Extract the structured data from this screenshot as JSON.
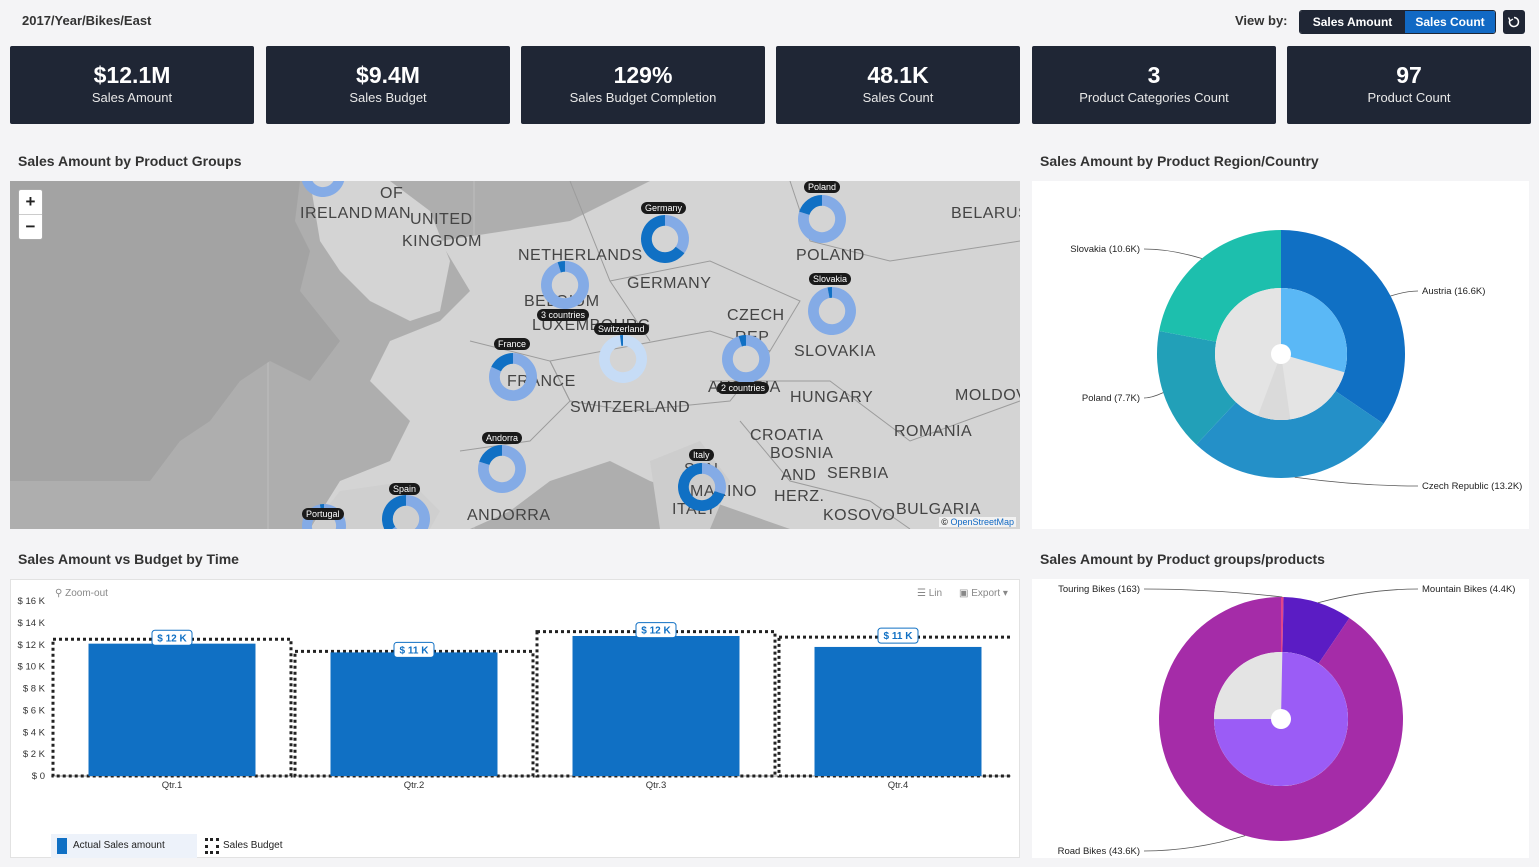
{
  "header": {
    "breadcrumb": "2017/Year/Bikes/East",
    "view_by_label": "View by:",
    "view_options": [
      "Sales Amount",
      "Sales Count"
    ],
    "reset_icon": "reset-icon"
  },
  "kpis": [
    {
      "value": "$12.1M",
      "label": "Sales Amount"
    },
    {
      "value": "$9.4M",
      "label": "Sales Budget"
    },
    {
      "value": "129%",
      "label": "Sales Budget Completion"
    },
    {
      "value": "48.1K",
      "label": "Sales Count"
    },
    {
      "value": "3",
      "label": "Product Categories Count"
    },
    {
      "value": "97",
      "label": "Product Count"
    }
  ],
  "sections": {
    "map_title": "Sales Amount by Product Groups",
    "region_title": "Sales Amount by Product Region/Country",
    "time_title": "Sales Amount vs Budget by Time",
    "products_title": "Sales Amount by Product groups/products"
  },
  "map": {
    "zoom_in": "+",
    "zoom_out": "−",
    "attribution_prefix": "©",
    "attribution_link": "OpenStreetMap",
    "place_labels": [
      "OF",
      "IRELAND",
      "MAN",
      "UNITED",
      "KINGDOM",
      "NETHERLANDS",
      "GERMANY",
      "BELGIUM",
      "LUXEMBOURG",
      "POLAND",
      "BELARUS",
      "CZECH",
      "REP",
      "SLOVAKIA",
      "FRANCE",
      "SWITZERLAND",
      "AUSTRIA",
      "HUNGARY",
      "MOLDOVA",
      "ROMANIA",
      "CROATIA",
      "BOSNIA",
      "AND",
      "HERZ.",
      "SERBIA",
      "KOSOVO",
      "BULGARIA",
      "ANDORRA",
      "ITALY",
      "SAN",
      "MARINO"
    ],
    "pins": [
      "Poland",
      "Germany",
      "Slovakia",
      "3 countries",
      "Switzerland",
      "France",
      "2 countries",
      "Andorra",
      "Italy",
      "Spain",
      "Portugal"
    ]
  },
  "chart_data": [
    {
      "type": "pie",
      "title": "Sales Amount by Product Region/Country",
      "slices": [
        {
          "label": "Austria (16.6K)",
          "value": 16.6
        },
        {
          "label": "Czech Republic (13.2K)",
          "value": 13.2
        },
        {
          "label": "Poland (7.7K)",
          "value": 7.7
        },
        {
          "label": "Slovakia (10.6K)",
          "value": 10.6
        }
      ],
      "colors": [
        "#1070c4",
        "#2490c8",
        "#22a0b8",
        "#1dbfad"
      ]
    },
    {
      "type": "bar",
      "title": "Sales Amount vs Budget by Time",
      "categories": [
        "Qtr.1",
        "Qtr.2",
        "Qtr.3",
        "Qtr.4"
      ],
      "series": [
        {
          "name": "Actual Sales amount",
          "values": [
            12.1,
            11.3,
            12.8,
            11.8
          ]
        },
        {
          "name": "Sales Budget",
          "values": [
            12.5,
            11.4,
            13.2,
            12.7
          ]
        }
      ],
      "data_labels": [
        "$ 12 K",
        "$ 11 K",
        "$ 12 K",
        "$ 11 K"
      ],
      "yticks": [
        "$ 0",
        "$ 2 K",
        "$ 4 K",
        "$ 6 K",
        "$ 8 K",
        "$ 10 K",
        "$ 12 K",
        "$ 14 K",
        "$ 16 K"
      ],
      "ylim": [
        0,
        16
      ],
      "toolbar": {
        "zoom": "Zoom-out",
        "scale": "Lin",
        "export": "Export"
      },
      "colors": {
        "actual": "#1070c4",
        "budget": "#222222"
      }
    },
    {
      "type": "pie",
      "title": "Sales Amount by Product groups/products",
      "slices": [
        {
          "label": "Mountain Bikes (4.4K)",
          "value": 4.4
        },
        {
          "label": "Road Bikes (43.6K)",
          "value": 43.6
        },
        {
          "label": "Touring Bikes (163)",
          "value": 0.163
        }
      ],
      "colors": [
        "#5b1cc4",
        "#a52ca8",
        "#e0458a"
      ]
    }
  ]
}
